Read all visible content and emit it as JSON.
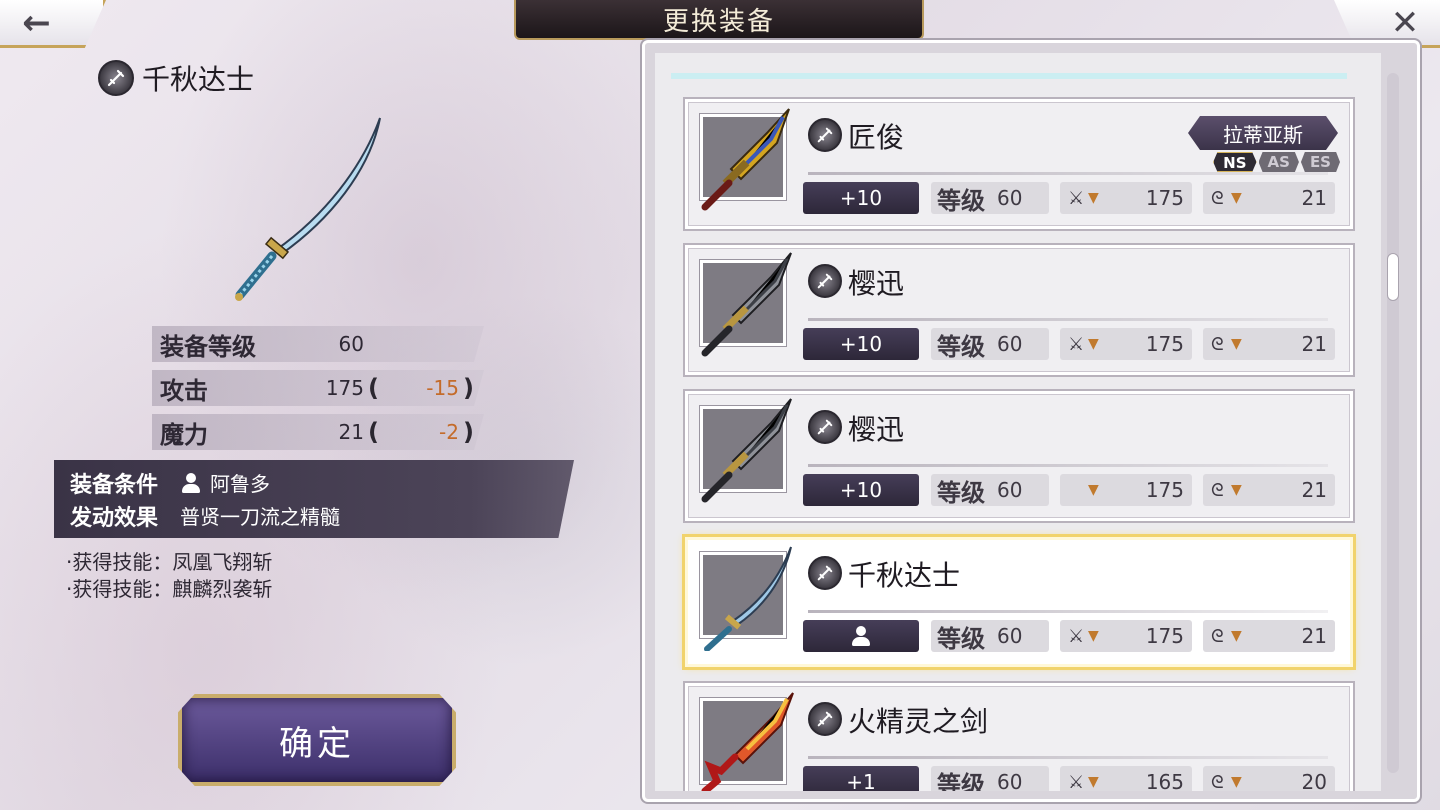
{
  "header": {
    "title": "更换装备",
    "back_icon": "←",
    "close_icon": "✕"
  },
  "detail": {
    "weapon_name": "千秋达士",
    "type_icon": "sword-type-icon",
    "stats": [
      {
        "label": "装备等级",
        "value": "60",
        "diff": ""
      },
      {
        "label": "攻击",
        "value": "175",
        "diff": "-15"
      },
      {
        "label": "魔力",
        "value": "21",
        "diff": "-2"
      }
    ],
    "condition_label": "装备条件",
    "condition_value": "阿鲁多",
    "effect_label": "发动效果",
    "effect_value": "普贤一刀流之精髓",
    "skills": [
      "·获得技能：凤凰飞翔斩",
      "·获得技能：麒麟烈袭斩"
    ],
    "confirm_label": "确定",
    "diff_color": "#c46b2a"
  },
  "list": {
    "items": [
      {
        "name": "匠俊",
        "plus": "+10",
        "level_label": "等级",
        "level": "60",
        "atk": "175",
        "mag": "21",
        "char_tag": "拉蒂亚斯",
        "tiers": [
          "NS",
          "AS",
          "ES"
        ],
        "active_tier": "NS",
        "blade_color": "#d4a520",
        "selected": false
      },
      {
        "name": "樱迅",
        "plus": "+10",
        "level_label": "等级",
        "level": "60",
        "atk": "175",
        "mag": "21",
        "blade_color": "#8e9198",
        "selected": false
      },
      {
        "name": "樱迅",
        "plus": "+10",
        "level_label": "等级",
        "level": "60",
        "atk": "175",
        "mag": "21",
        "blade_color": "#8e9198",
        "selected": false
      },
      {
        "name": "千秋达士",
        "plus": "",
        "level_label": "等级",
        "level": "60",
        "atk": "175",
        "mag": "21",
        "blade_color": "#9fc8e6",
        "selected": true
      },
      {
        "name": "火精灵之剑",
        "plus": "+1",
        "level_label": "等级",
        "level": "60",
        "atk": "165",
        "mag": "20",
        "blade_color": "#d8381e",
        "selected": false
      }
    ]
  },
  "colors": {
    "accent_gold": "#c9ad6b",
    "chip_dark": "#2d2739",
    "arrow_orange": "#c17a2e",
    "selected_glow": "#f1d36c"
  }
}
